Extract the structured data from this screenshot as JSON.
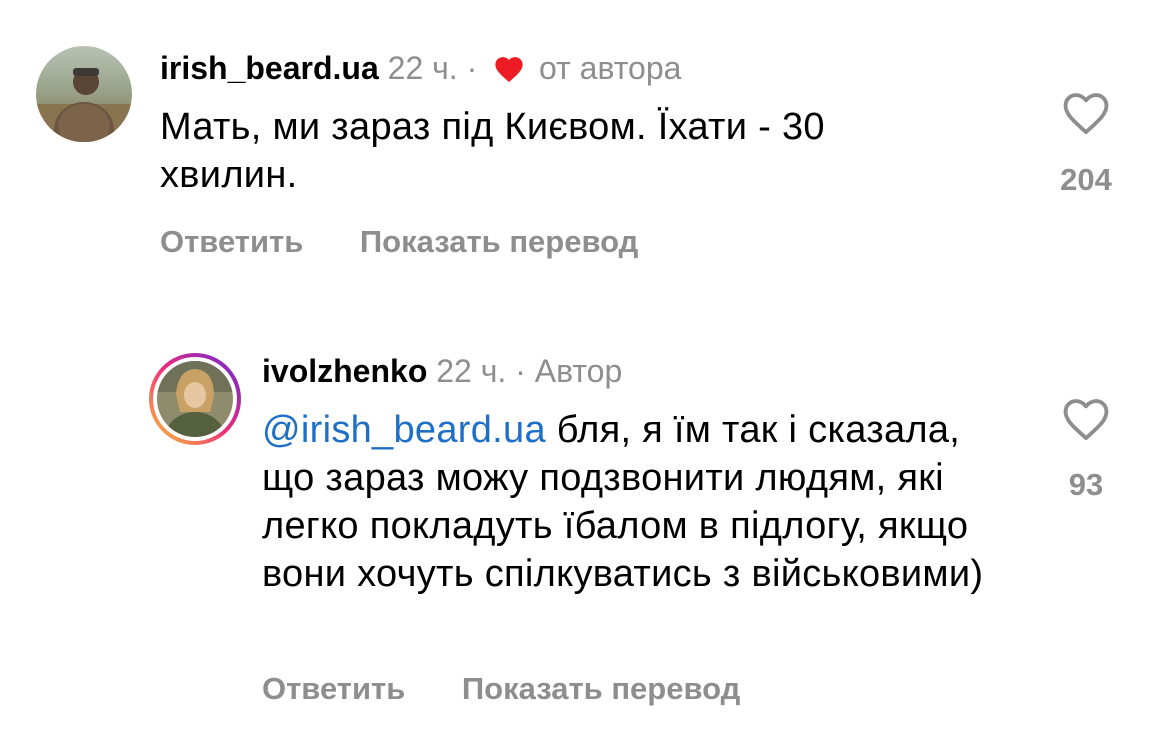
{
  "comments": [
    {
      "username": "irish_beard.ua",
      "time": "22 ч.",
      "separator": "·",
      "badge": "от автора",
      "badge_icon": "heart-filled-icon",
      "text": "Мать, ми зараз під Києвом. Їхати - 30 хвилин.",
      "likes": "204",
      "reply_label": "Ответить",
      "translate_label": "Показать перевод"
    },
    {
      "username": "ivolzhenko",
      "time": "22 ч.",
      "separator": "·",
      "badge": "Автор",
      "mention": "@irish_beard.ua",
      "text": " бля, я їм так і сказала, що зараз можу подзвонити людям, які легко покладуть їбалом в підлогу, якщо вони хочуть спілкуватись з військовими)",
      "likes": "93",
      "reply_label": "Ответить",
      "translate_label": "Показать перевод"
    }
  ],
  "colors": {
    "muted": "#8e8e8e",
    "mention": "#1e6fc8",
    "heart_red": "#ed1c24",
    "story_ring": [
      "#f9ce34",
      "#ee2a7b",
      "#6228d7"
    ]
  }
}
